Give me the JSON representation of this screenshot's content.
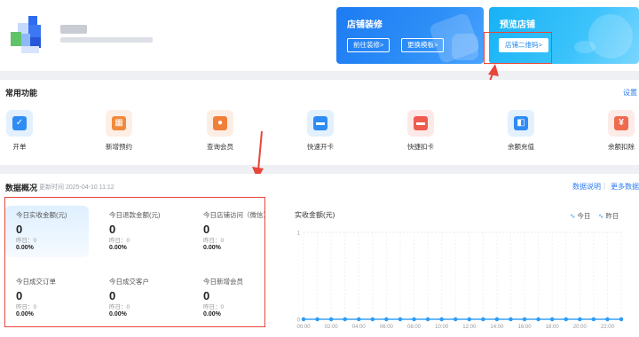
{
  "header": {
    "banner_decorate": {
      "title": "店铺装修",
      "btn_goto": "前往装修>",
      "btn_change": "更换模板>"
    },
    "banner_preview": {
      "title": "预览店铺",
      "btn_qrcode": "店铺二维码>"
    }
  },
  "functions": {
    "title": "常用功能",
    "settings": "设置",
    "items": [
      {
        "label": "开单",
        "icon": "order-icon",
        "color": "#2f8cf5"
      },
      {
        "label": "新增预约",
        "icon": "calendar-icon",
        "color": "#f08a3c"
      },
      {
        "label": "查询会员",
        "icon": "member-icon",
        "color": "#f07f3a"
      },
      {
        "label": "快速开卡",
        "icon": "card-icon",
        "color": "#2f8cf5"
      },
      {
        "label": "快捷扣卡",
        "icon": "deduct-card-icon",
        "color": "#ef5b4f"
      },
      {
        "label": "余额充值",
        "icon": "wallet-icon",
        "color": "#2f8cf5"
      },
      {
        "label": "余额扣除",
        "icon": "yen-icon",
        "color": "#ef6a4f"
      }
    ]
  },
  "overview": {
    "title": "数据概况",
    "updated": "更新时间 2025-04-10 11:12",
    "link_help": "数据说明",
    "divider": "|",
    "link_more": "更多数据",
    "stats": [
      {
        "label": "今日实收金额(元)",
        "value": "0",
        "yesterday": "昨日：0",
        "pct": "0.00%"
      },
      {
        "label": "今日退款金额(元)",
        "value": "0",
        "yesterday": "昨日：0",
        "pct": "0.00%"
      },
      {
        "label": "今日店铺访问（微信）",
        "value": "0",
        "yesterday": "昨日：0",
        "pct": "0.00%"
      },
      {
        "label": "今日成交订单",
        "value": "0",
        "yesterday": "昨日：0",
        "pct": "0.00%"
      },
      {
        "label": "今日成交客户",
        "value": "0",
        "yesterday": "昨日：0",
        "pct": "0.00%"
      },
      {
        "label": "今日新增会员",
        "value": "0",
        "yesterday": "昨日：0",
        "pct": "0.00%"
      }
    ]
  },
  "chart_data": {
    "type": "line",
    "title": "实收金额(元)",
    "legend": [
      "今日",
      "昨日"
    ],
    "legend_position": "top-right",
    "x": [
      "00:00",
      "01:00",
      "02:00",
      "03:00",
      "04:00",
      "05:00",
      "06:00",
      "07:00",
      "08:00",
      "09:00",
      "10:00",
      "11:00",
      "12:00",
      "13:00",
      "14:00",
      "15:00",
      "16:00",
      "17:00",
      "18:00",
      "19:00",
      "20:00",
      "21:00",
      "22:00",
      "23:00"
    ],
    "tick_labels": [
      "00:00",
      "02:00",
      "04:00",
      "06:00",
      "08:00",
      "10:00",
      "12:00",
      "14:00",
      "16:00",
      "18:00",
      "20:00",
      "22:00"
    ],
    "series": [
      {
        "name": "今日",
        "values": [
          0,
          0,
          0,
          0,
          0,
          0,
          0,
          0,
          0,
          0,
          0,
          0,
          0,
          0,
          0,
          0,
          0,
          0,
          0,
          0,
          0,
          0,
          0,
          0
        ]
      },
      {
        "name": "昨日",
        "values": [
          0,
          0,
          0,
          0,
          0,
          0,
          0,
          0,
          0,
          0,
          0,
          0,
          0,
          0,
          0,
          0,
          0,
          0,
          0,
          0,
          0,
          0,
          0,
          0
        ]
      }
    ],
    "ylim": [
      0,
      1
    ],
    "yticks": [
      "0",
      "1"
    ],
    "grid": true,
    "color": "#2d9cf5"
  }
}
